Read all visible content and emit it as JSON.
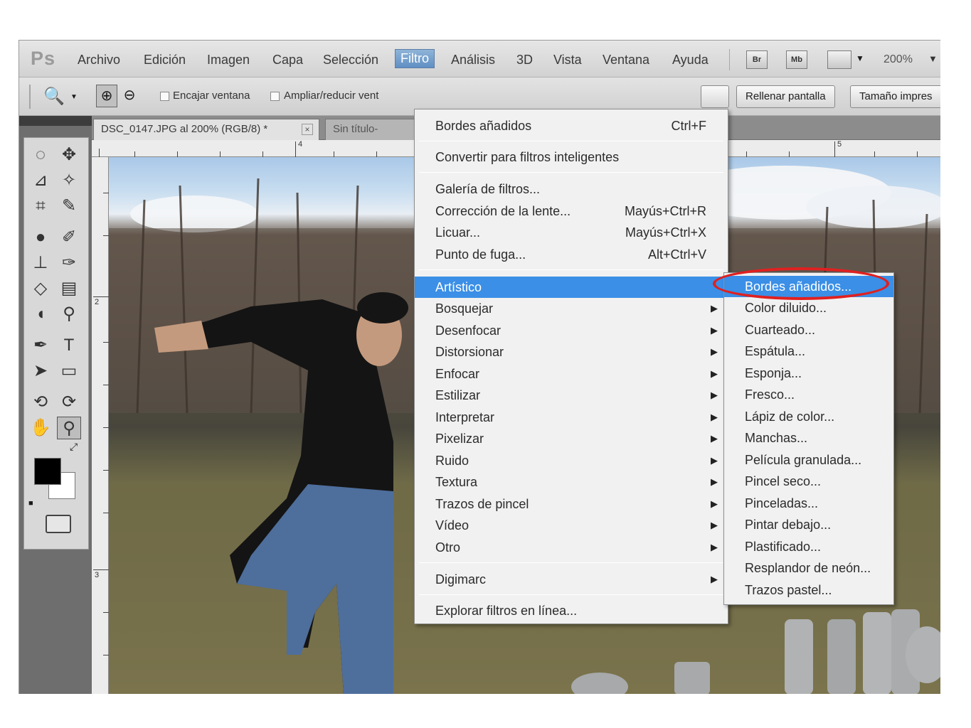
{
  "app": {
    "logo": "Ps"
  },
  "menubar": {
    "items": [
      "Archivo",
      "Edición",
      "Imagen",
      "Capa",
      "Selección",
      "Filtro",
      "Análisis",
      "3D",
      "Vista",
      "Ventana",
      "Ayuda"
    ],
    "active": "Filtro",
    "icons": [
      "Br",
      "Mb"
    ],
    "zoom": "200%"
  },
  "options_bar": {
    "fit_window": "Encajar ventana",
    "resize": "Ampliar/reducir vent",
    "fill_screen": "Rellenar pantalla",
    "print_size": "Tamaño impres"
  },
  "tabs": {
    "active": "DSC_0147.JPG al 200% (RGB/8) *",
    "inactive": "Sin título-"
  },
  "rulers": {
    "top": [
      "4",
      "5"
    ],
    "left": [
      "2",
      "3"
    ]
  },
  "filter_menu": {
    "top": [
      {
        "label": "Bordes añadidos",
        "shortcut": "Ctrl+F"
      },
      {
        "label": "Convertir para filtros inteligentes"
      }
    ],
    "special": [
      {
        "label": "Galería de filtros..."
      },
      {
        "label": "Corrección de la lente...",
        "shortcut": "Mayús+Ctrl+R"
      },
      {
        "label": "Licuar...",
        "shortcut": "Mayús+Ctrl+X"
      },
      {
        "label": "Punto de fuga...",
        "shortcut": "Alt+Ctrl+V"
      }
    ],
    "categories": [
      "Artístico",
      "Bosquejar",
      "Desenfocar",
      "Distorsionar",
      "Enfocar",
      "Estilizar",
      "Interpretar",
      "Pixelizar",
      "Ruido",
      "Textura",
      "Trazos de pincel",
      "Vídeo",
      "Otro"
    ],
    "highlighted": "Artístico",
    "digimarc": "Digimarc",
    "explore": "Explorar filtros en línea..."
  },
  "submenu": {
    "items": [
      "Bordes añadidos...",
      "Color diluido...",
      "Cuarteado...",
      "Espátula...",
      "Esponja...",
      "Fresco...",
      "Lápiz de color...",
      "Manchas...",
      "Película granulada...",
      "Pincel seco...",
      "Pinceladas...",
      "Pintar debajo...",
      "Plastificado...",
      "Resplandor de neón...",
      "Trazos pastel..."
    ],
    "highlighted": "Bordes añadidos...",
    "annotation_color": "#e02020"
  },
  "colors": {
    "highlight": "#3b8fe6"
  },
  "tool_icons": [
    "marquee-icon",
    "move-icon",
    "lasso-icon",
    "quick-select-icon",
    "crop-icon",
    "eyedropper-icon",
    "spot-heal-icon",
    "brush-icon",
    "stamp-icon",
    "history-brush-icon",
    "eraser-icon",
    "gradient-icon",
    "blur-icon",
    "dodge-icon",
    "pen-icon",
    "type-icon",
    "path-select-icon",
    "shape-icon",
    "3d-rotate-icon",
    "3d-orbit-icon",
    "hand-icon",
    "zoom-icon"
  ]
}
